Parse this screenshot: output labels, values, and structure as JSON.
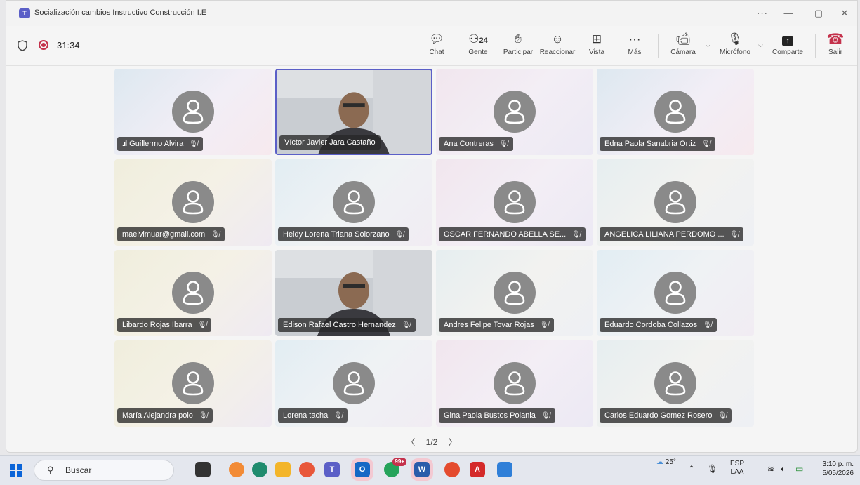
{
  "window": {
    "title": "Socialización cambios Instructivo Construcción I.E"
  },
  "meeting": {
    "elapsed": "31:34",
    "page_indicator": "1/2"
  },
  "toolbar": {
    "chat": "Chat",
    "people_count": "24",
    "people": "Gente",
    "raise": "Participar",
    "react": "Reaccionar",
    "view": "Vista",
    "more": "Más",
    "camera": "Cámara",
    "mic": "Micrófono",
    "share": "Comparte",
    "leave": "Salir"
  },
  "participants": [
    {
      "name": "Guillermo Alvira",
      "video": false,
      "muted": true,
      "signal": true
    },
    {
      "name": "Víctor Javier Jara Castaño",
      "video": true,
      "muted": false,
      "active": true
    },
    {
      "name": "Ana Contreras",
      "video": false,
      "muted": true
    },
    {
      "name": "Edna Paola Sanabria Ortiz",
      "video": false,
      "muted": true
    },
    {
      "name": "maelvimuar@gmail.com",
      "video": false,
      "muted": true
    },
    {
      "name": "Heidy Lorena Triana Solorzano",
      "video": false,
      "muted": true
    },
    {
      "name": "OSCAR FERNANDO ABELLA SE...",
      "video": false,
      "muted": true
    },
    {
      "name": "ANGELICA LILIANA PERDOMO ...",
      "video": false,
      "muted": true
    },
    {
      "name": "Libardo Rojas Ibarra",
      "video": false,
      "muted": true
    },
    {
      "name": "Edison Rafael Castro Hernandez",
      "video": true,
      "muted": true
    },
    {
      "name": "Andres Felipe Tovar Rojas",
      "video": false,
      "muted": true
    },
    {
      "name": "Eduardo Cordoba Collazos",
      "video": false,
      "muted": true
    },
    {
      "name": "María Alejandra polo",
      "video": false,
      "muted": true
    },
    {
      "name": "Lorena tacha",
      "video": false,
      "muted": true
    },
    {
      "name": "Gina Paola Bustos Polania",
      "video": false,
      "muted": true
    },
    {
      "name": "Carlos Eduardo Gomez Rosero",
      "video": false,
      "muted": true
    }
  ],
  "taskbar": {
    "search_placeholder": "Buscar",
    "whatsapp_badge": "99+",
    "weather": "25°",
    "lang_top": "ESP",
    "lang_bottom": "LAA",
    "time": "3:10 p. m.",
    "date": "5/05/2026"
  }
}
